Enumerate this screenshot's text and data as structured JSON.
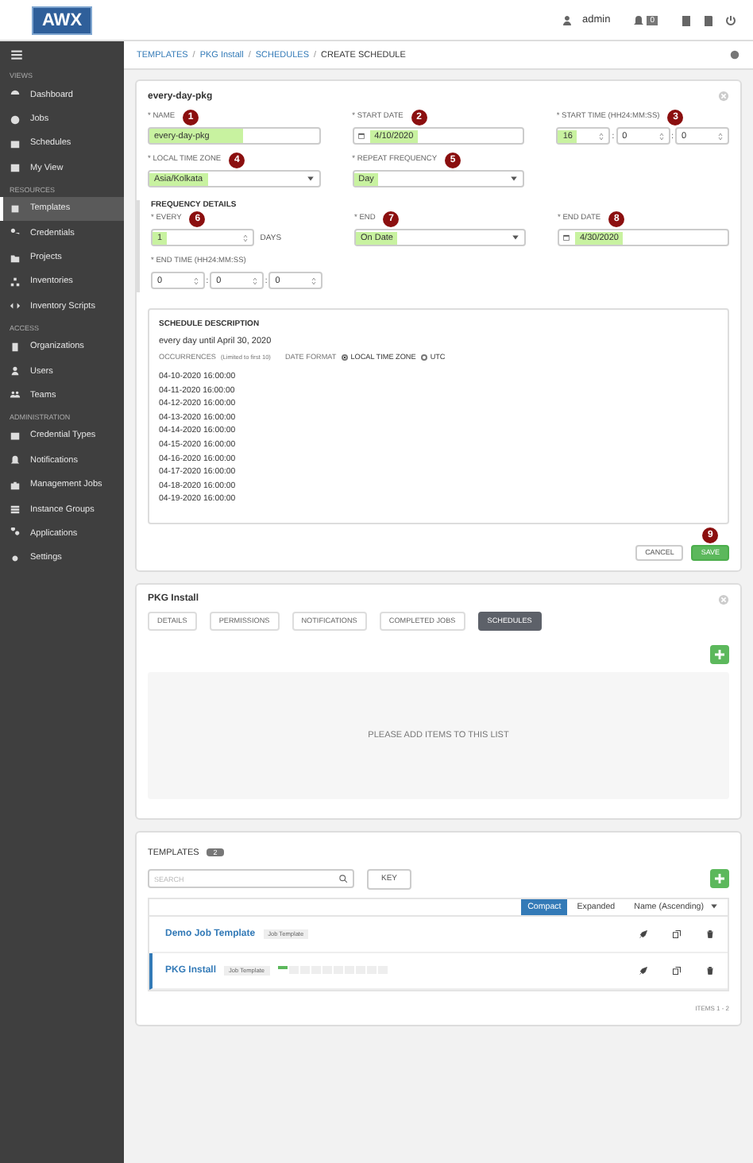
{
  "header": {
    "logo": "AWX",
    "user": "admin",
    "notification_count": "0"
  },
  "sidebar": {
    "sections": [
      {
        "heading": "VIEWS",
        "items": [
          {
            "label": "Dashboard",
            "selected": false
          },
          {
            "label": "Jobs",
            "selected": false
          },
          {
            "label": "Schedules",
            "selected": false
          },
          {
            "label": "My View",
            "selected": false
          }
        ]
      },
      {
        "heading": "RESOURCES",
        "items": [
          {
            "label": "Templates",
            "selected": true
          },
          {
            "label": "Credentials",
            "selected": false
          },
          {
            "label": "Projects",
            "selected": false
          },
          {
            "label": "Inventories",
            "selected": false
          },
          {
            "label": "Inventory Scripts",
            "selected": false
          }
        ]
      },
      {
        "heading": "ACCESS",
        "items": [
          {
            "label": "Organizations",
            "selected": false
          },
          {
            "label": "Users",
            "selected": false
          },
          {
            "label": "Teams",
            "selected": false
          }
        ]
      },
      {
        "heading": "ADMINISTRATION",
        "items": [
          {
            "label": "Credential Types",
            "selected": false
          },
          {
            "label": "Notifications",
            "selected": false
          },
          {
            "label": "Management Jobs",
            "selected": false
          },
          {
            "label": "Instance Groups",
            "selected": false
          },
          {
            "label": "Applications",
            "selected": false
          },
          {
            "label": "Settings",
            "selected": false
          }
        ]
      }
    ]
  },
  "breadcrumb": [
    {
      "kind": "link",
      "text": "TEMPLATES"
    },
    {
      "kind": "separator",
      "text": "/"
    },
    {
      "kind": "link",
      "text": "PKG Install"
    },
    {
      "kind": "separator",
      "text": "/"
    },
    {
      "kind": "link",
      "text": "SCHEDULES"
    },
    {
      "kind": "separator",
      "text": "/"
    },
    {
      "kind": "current",
      "text": "CREATE SCHEDULE"
    }
  ],
  "schedule_form": {
    "title": "every-day-pkg",
    "fields": [
      {
        "kind": "text",
        "label": "* NAME",
        "marker": "1",
        "value": "every-day-pkg",
        "highlighted": true
      },
      {
        "kind": "date",
        "label": "* START DATE",
        "marker": "2",
        "value": "4/10/2020",
        "highlighted": true
      },
      {
        "kind": "time",
        "label": "* START TIME (HH24:MM:SS)",
        "marker": "3",
        "parts": [
          {
            "kind": "spin",
            "value": "16",
            "highlighted": true
          },
          {
            "kind": "separator",
            "value": ":"
          },
          {
            "kind": "spin",
            "value": "0",
            "highlighted": false
          },
          {
            "kind": "separator",
            "value": ":"
          },
          {
            "kind": "spin",
            "value": "0",
            "highlighted": false
          }
        ]
      },
      {
        "kind": "select",
        "label": "* LOCAL TIME ZONE",
        "marker": "4",
        "value": "Asia/Kolkata",
        "highlighted": true
      },
      {
        "kind": "select",
        "label": "* REPEAT FREQUENCY",
        "marker": "5",
        "value": "Day",
        "highlighted": true
      }
    ],
    "frequency_heading": "FREQUENCY DETAILS",
    "frequency_fields": [
      {
        "kind": "number",
        "label": "* EVERY",
        "marker": "6",
        "value": "1",
        "unit": "DAYS",
        "highlighted": true
      },
      {
        "kind": "select",
        "label": "* END",
        "marker": "7",
        "value": "On Date",
        "highlighted": true
      },
      {
        "kind": "date",
        "label": "* END DATE",
        "marker": "8",
        "value": "4/30/2020",
        "highlighted": true
      },
      {
        "kind": "time",
        "label": "* END TIME (HH24:MM:SS)",
        "parts": [
          {
            "kind": "spin",
            "value": "0",
            "highlighted": false
          },
          {
            "kind": "separator",
            "value": ":"
          },
          {
            "kind": "spin",
            "value": "0",
            "highlighted": false
          },
          {
            "kind": "separator",
            "value": ":"
          },
          {
            "kind": "spin",
            "value": "0",
            "highlighted": false
          }
        ]
      }
    ],
    "description": {
      "heading": "SCHEDULE DESCRIPTION",
      "summary": "every day until April 30, 2020",
      "occurrences_label": "OCCURRENCES",
      "occurrences_note": "(Limited to first 10)",
      "date_format_label": "DATE FORMAT",
      "date_formats": [
        {
          "label": "LOCAL TIME ZONE",
          "selected": true
        },
        {
          "label": "UTC",
          "selected": false
        }
      ],
      "occurrences": [
        "04-10-2020 16:00:00",
        "04-11-2020 16:00:00",
        "04-12-2020 16:00:00",
        "04-13-2020 16:00:00",
        "04-14-2020 16:00:00",
        "04-15-2020 16:00:00",
        "04-16-2020 16:00:00",
        "04-17-2020 16:00:00",
        "04-18-2020 16:00:00",
        "04-19-2020 16:00:00"
      ]
    },
    "cancel": "CANCEL",
    "save": "SAVE",
    "save_marker": "9"
  },
  "template_card": {
    "title": "PKG Install",
    "tabs": [
      {
        "label": "DETAILS",
        "selected": false
      },
      {
        "label": "PERMISSIONS",
        "selected": false
      },
      {
        "label": "NOTIFICATIONS",
        "selected": false
      },
      {
        "label": "COMPLETED JOBS",
        "selected": false
      },
      {
        "label": "SCHEDULES",
        "selected": true
      }
    ],
    "empty_message": "PLEASE ADD ITEMS TO THIS LIST"
  },
  "templates": {
    "title": "TEMPLATES",
    "count": "2",
    "search": {
      "placeholder": "SEARCH"
    },
    "key": "KEY",
    "views": [
      {
        "label": "Compact",
        "selected": true
      },
      {
        "label": "Expanded",
        "selected": false
      }
    ],
    "sort": "Name (Ascending)",
    "rows": [
      {
        "name": "Demo Job Template",
        "type": "Job Template",
        "selected": false,
        "jobs": []
      },
      {
        "name": "PKG Install",
        "type": "Job Template",
        "selected": true,
        "jobs": [
          {
            "kind": "success"
          },
          {
            "kind": "empty"
          },
          {
            "kind": "empty"
          },
          {
            "kind": "empty"
          },
          {
            "kind": "empty"
          },
          {
            "kind": "empty"
          },
          {
            "kind": "empty"
          },
          {
            "kind": "empty"
          },
          {
            "kind": "empty"
          },
          {
            "kind": "empty"
          }
        ]
      }
    ],
    "footer": "ITEMS 1 - 2"
  }
}
